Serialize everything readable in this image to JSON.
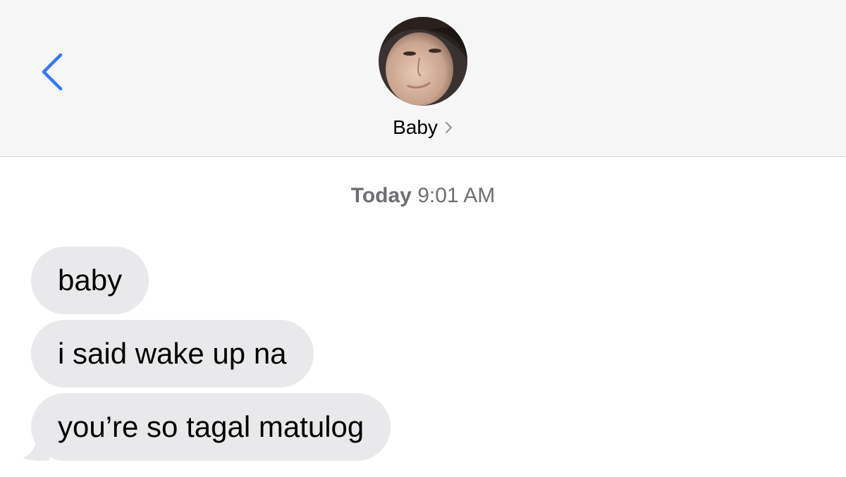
{
  "header": {
    "back_icon": "chevron-left-icon",
    "accent_color": "#3478f6",
    "contact": {
      "name": "Baby",
      "disclosure_icon": "chevron-right-icon",
      "avatar_icon": "contact-photo"
    }
  },
  "conversation": {
    "timestamp": {
      "day": "Today",
      "time": "9:01 AM"
    },
    "bubble_color": "#e9e9eb",
    "messages": [
      {
        "text": "baby",
        "direction": "received"
      },
      {
        "text": "i said wake up na",
        "direction": "received"
      },
      {
        "text": "you’re so tagal matulog",
        "direction": "received"
      }
    ]
  }
}
